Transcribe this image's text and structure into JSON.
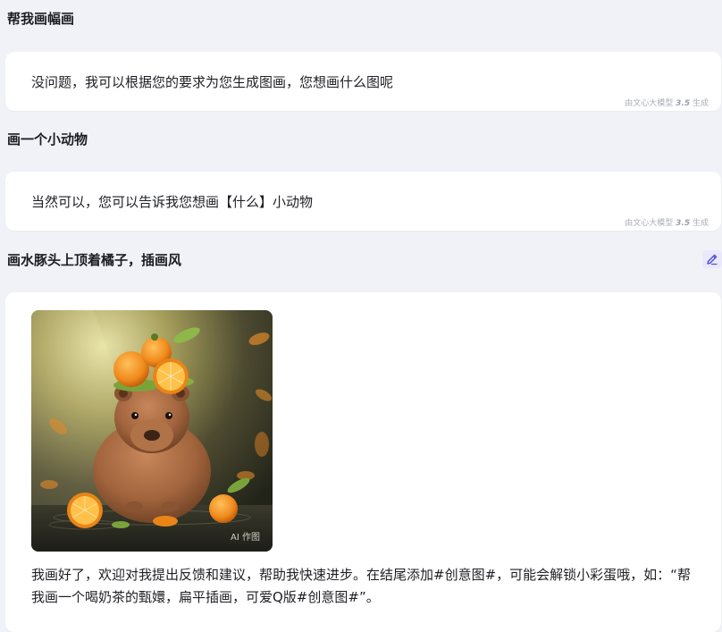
{
  "conversation": {
    "turns": [
      {
        "user": "帮我画幅画",
        "bot": "没问题，我可以根据您的要求为您生成图画，您想画什么图呢",
        "footnote_prefix": "由文心大模型 ",
        "footnote_version": "3.5",
        "footnote_suffix": " 生成"
      },
      {
        "user": "画一个小动物",
        "bot": "当然可以，您可以告诉我您想画【什么】小动物",
        "footnote_prefix": "由文心大模型 ",
        "footnote_version": "3.5",
        "footnote_suffix": " 生成"
      },
      {
        "user": "画水豚头上顶着橘子，插画风",
        "bot_image_badge": "AI 作图",
        "bot": "我画好了，欢迎对我提出反馈和建议，帮助我快速进步。在结尾添加#创意图#，可能会解锁小彩蛋哦，如：“帮我画一个喝奶茶的甄嬛，扁平插画，可爱Q版#创意图#”。"
      }
    ]
  },
  "icons": {
    "edit": "pencil-icon"
  },
  "colors": {
    "page_bg": "#f1f2f7",
    "card_bg": "#ffffff",
    "edit_accent": "#4b4fd6"
  }
}
